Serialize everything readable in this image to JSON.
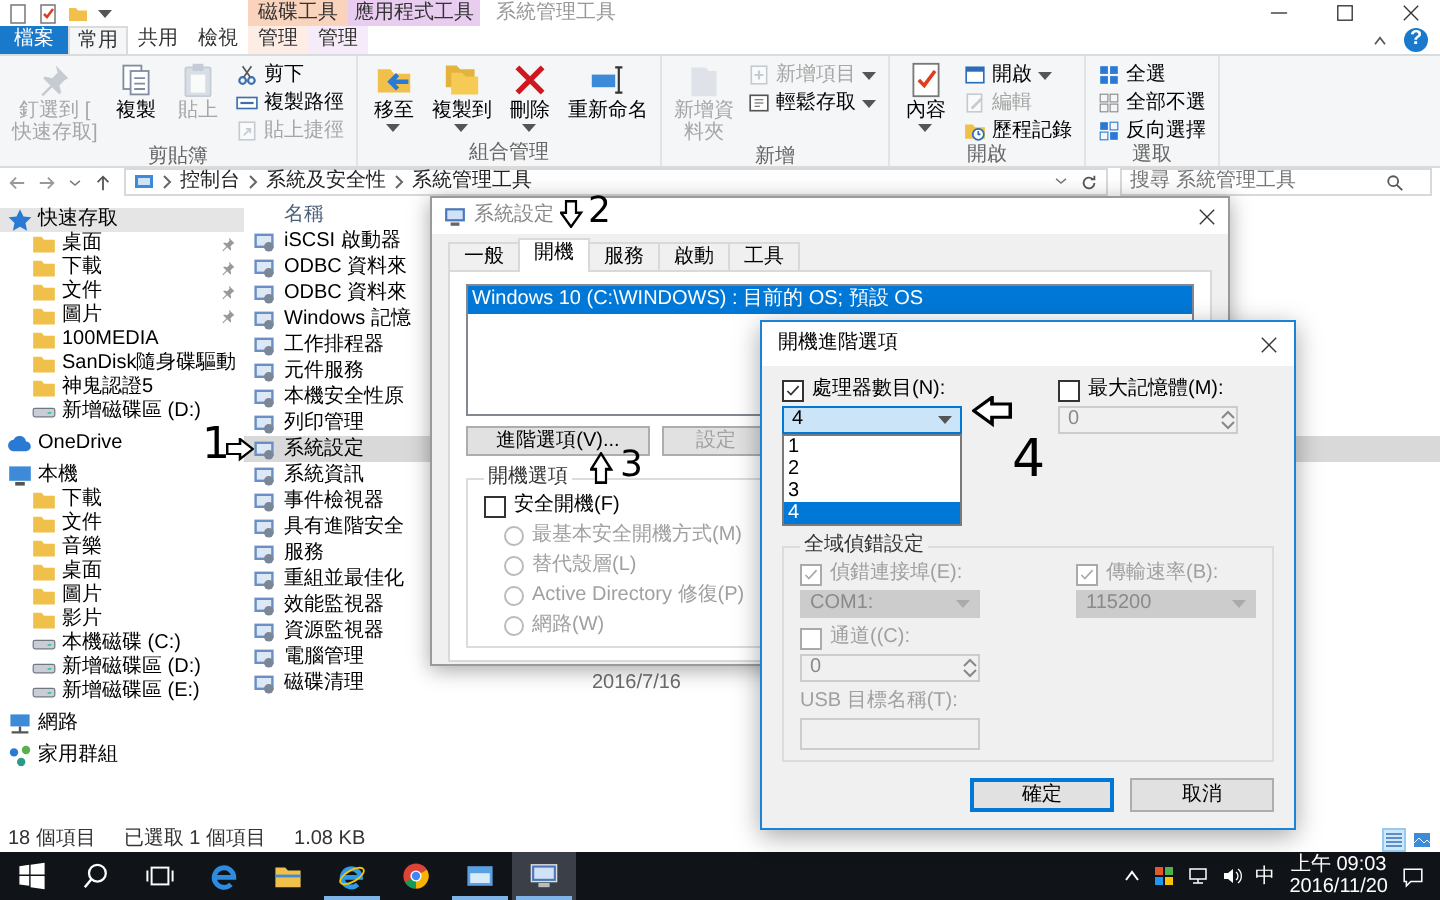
{
  "explorer": {
    "context_tabs": [
      {
        "group": "磁碟工具",
        "tab": "管理",
        "color": "#f9d3bc",
        "selected": false
      },
      {
        "group": "應用程式工具",
        "tab": "管理",
        "color": "#e9cdf0",
        "selected": false
      }
    ],
    "title": "系統管理工具",
    "ribbon_tabs": [
      {
        "label": "檔案",
        "kind": "file",
        "selected": false
      },
      {
        "label": "常用",
        "kind": "tab",
        "selected": true
      },
      {
        "label": "共用",
        "kind": "tab",
        "selected": false
      },
      {
        "label": "檢視",
        "kind": "tab",
        "selected": false
      }
    ],
    "help": "?",
    "ribbon_groups": [
      {
        "label": "剪貼簿",
        "commands": [
          {
            "label": "釘選到 [\n快速存取]",
            "kind": "large",
            "disabled": true,
            "dropdown": false
          },
          {
            "label": "複製",
            "kind": "large",
            "disabled": false,
            "dropdown": false
          },
          {
            "label": "貼上",
            "kind": "large",
            "disabled": true,
            "dropdown": false
          },
          {
            "label": "剪下",
            "kind": "small",
            "disabled": false,
            "dropdown": false
          },
          {
            "label": "複製路徑",
            "kind": "small",
            "disabled": false,
            "dropdown": false
          },
          {
            "label": "貼上捷徑",
            "kind": "small",
            "disabled": true,
            "dropdown": false
          }
        ]
      },
      {
        "label": "組合管理",
        "commands": [
          {
            "label": "移至",
            "kind": "large",
            "disabled": false,
            "dropdown": true
          },
          {
            "label": "複製到",
            "kind": "large",
            "disabled": false,
            "dropdown": true
          },
          {
            "label": "刪除",
            "kind": "large",
            "disabled": false,
            "dropdown": true
          },
          {
            "label": "重新命名",
            "kind": "large",
            "disabled": false,
            "dropdown": false
          }
        ]
      },
      {
        "label": "新增",
        "commands": [
          {
            "label": "新增資料夾",
            "kind": "large",
            "disabled": true,
            "dropdown": false
          },
          {
            "label": "新增項目",
            "kind": "small",
            "disabled": true,
            "dropdown": true
          },
          {
            "label": "輕鬆存取",
            "kind": "small",
            "disabled": false,
            "dropdown": true
          }
        ]
      },
      {
        "label": "開啟",
        "commands": [
          {
            "label": "內容",
            "kind": "large",
            "disabled": false,
            "dropdown": true
          },
          {
            "label": "開啟",
            "kind": "small",
            "disabled": false,
            "dropdown": true
          },
          {
            "label": "編輯",
            "kind": "small",
            "disabled": true,
            "dropdown": false
          },
          {
            "label": "歷程記錄",
            "kind": "small",
            "disabled": false,
            "dropdown": false
          }
        ]
      },
      {
        "label": "選取",
        "commands": [
          {
            "label": "全選",
            "kind": "small",
            "disabled": false,
            "dropdown": false
          },
          {
            "label": "全部不選",
            "kind": "small",
            "disabled": false,
            "dropdown": false
          },
          {
            "label": "反向選擇",
            "kind": "small",
            "disabled": false,
            "dropdown": false
          }
        ]
      }
    ],
    "address": {
      "path": [
        "控制台",
        "系統及安全性",
        "系統管理工具"
      ]
    },
    "search": {
      "placeholder": "搜尋 系統管理工具"
    },
    "nav": [
      {
        "label": "快速存取",
        "kind": "star",
        "selected": true,
        "children": [
          {
            "label": "桌面",
            "kind": "folder",
            "selected": false,
            "pinned": true
          },
          {
            "label": "下載",
            "kind": "folder",
            "selected": false,
            "pinned": true
          },
          {
            "label": "文件",
            "kind": "folder",
            "selected": false,
            "pinned": true
          },
          {
            "label": "圖片",
            "kind": "folder",
            "selected": false,
            "pinned": true
          },
          {
            "label": "100MEDIA",
            "kind": "folder",
            "selected": false,
            "pinned": false
          },
          {
            "label": "SanDisk隨身碟驅動",
            "kind": "folder",
            "selected": false,
            "pinned": false
          },
          {
            "label": "神鬼認證5",
            "kind": "folder",
            "selected": false,
            "pinned": false
          },
          {
            "label": "新增磁碟區 (D:)",
            "kind": "drive",
            "selected": false,
            "pinned": false
          }
        ]
      },
      {
        "label": "OneDrive",
        "kind": "cloud",
        "selected": false
      },
      {
        "label": "本機",
        "kind": "pc",
        "selected": false,
        "children": [
          {
            "label": "下載",
            "kind": "folder",
            "selected": false
          },
          {
            "label": "文件",
            "kind": "folder",
            "selected": false
          },
          {
            "label": "音樂",
            "kind": "folder",
            "selected": false
          },
          {
            "label": "桌面",
            "kind": "folder",
            "selected": false
          },
          {
            "label": "圖片",
            "kind": "folder",
            "selected": false
          },
          {
            "label": "影片",
            "kind": "folder",
            "selected": false
          },
          {
            "label": "本機磁碟 (C:)",
            "kind": "drive",
            "selected": false
          },
          {
            "label": "新增磁碟區 (D:)",
            "kind": "drive",
            "selected": false
          },
          {
            "label": "新增磁碟區 (E:)",
            "kind": "drive",
            "selected": false
          }
        ]
      },
      {
        "label": "網路",
        "kind": "network",
        "selected": false
      },
      {
        "label": "家用群組",
        "kind": "homegroup",
        "selected": false
      }
    ],
    "columns": [
      "名稱"
    ],
    "files": [
      {
        "name": "iSCSI 啟動器",
        "selected": false
      },
      {
        "name": "ODBC 資料來",
        "selected": false
      },
      {
        "name": "ODBC 資料來",
        "selected": false
      },
      {
        "name": "Windows 記憶",
        "selected": false
      },
      {
        "name": "工作排程器",
        "selected": false
      },
      {
        "name": "元件服務",
        "selected": false
      },
      {
        "name": "本機安全性原",
        "selected": false
      },
      {
        "name": "列印管理",
        "selected": false
      },
      {
        "name": "系統設定",
        "selected": true
      },
      {
        "name": "系統資訊",
        "selected": false
      },
      {
        "name": "事件檢視器",
        "selected": false
      },
      {
        "name": "具有進階安全",
        "selected": false
      },
      {
        "name": "服務",
        "selected": false
      },
      {
        "name": "重組並最佳化",
        "selected": false
      },
      {
        "name": "效能監視器",
        "selected": false
      },
      {
        "name": "資源監視器",
        "selected": false
      },
      {
        "name": "電腦管理",
        "selected": false
      },
      {
        "name": "磁碟清理",
        "selected": false,
        "date": "2016/7/16"
      }
    ],
    "status": {
      "count": "18 個項目",
      "selection": "已選取 1 個項目",
      "size": "1.08 KB"
    },
    "view_buttons": [
      {
        "selected": true
      },
      {
        "selected": false
      }
    ]
  },
  "system_config": {
    "title": "系統設定",
    "tabs": [
      {
        "label": "一般",
        "selected": false
      },
      {
        "label": "開機",
        "selected": true
      },
      {
        "label": "服務",
        "selected": false
      },
      {
        "label": "啟動",
        "selected": false
      },
      {
        "label": "工具",
        "selected": false
      }
    ],
    "boot_entries": [
      {
        "label": "Windows 10 (C:\\WINDOWS) : 目前的 OS; 預設 OS",
        "selected": true
      }
    ],
    "buttons": [
      {
        "label": "進階選項(V)...",
        "disabled": false
      },
      {
        "label": "設定",
        "disabled": true
      }
    ],
    "boot_options": {
      "label": "開機選項",
      "safe_boot": {
        "label": "安全開機(F)",
        "checked": false
      },
      "modes": [
        {
          "label": "最基本安全開機方式(M)",
          "selected": false,
          "disabled": true
        },
        {
          "label": "替代殼層(L)",
          "selected": false,
          "disabled": true
        },
        {
          "label": "Active Directory 修復(P)",
          "selected": false,
          "disabled": true
        },
        {
          "label": "網路(W)",
          "selected": false,
          "disabled": true
        }
      ]
    }
  },
  "advanced_boot": {
    "title": "開機進階選項",
    "processors": {
      "label": "處理器數目(N):",
      "checked": true,
      "value": "4",
      "options": [
        {
          "label": "1",
          "selected": false
        },
        {
          "label": "2",
          "selected": false
        },
        {
          "label": "3",
          "selected": false
        },
        {
          "label": "4",
          "selected": true
        }
      ]
    },
    "max_memory": {
      "label": "最大記憶體(M):",
      "checked": false,
      "value": "0",
      "disabled": true
    },
    "debug": {
      "label": "全域偵錯設定",
      "port": {
        "label": "偵錯連接埠(E):",
        "checked": true,
        "disabled": true,
        "value": "COM1:"
      },
      "baud": {
        "label": "傳輸速率(B):",
        "checked": true,
        "disabled": true,
        "value": "115200"
      },
      "channel": {
        "label": "通道((C):",
        "checked": false,
        "disabled": true,
        "value": "0"
      },
      "usb": {
        "label": "USB 目標名稱(T):",
        "disabled": true
      }
    },
    "buttons": [
      {
        "label": "確定",
        "default": true
      },
      {
        "label": "取消",
        "default": false
      }
    ]
  },
  "annotations": [
    {
      "label": "1",
      "kind": "arrow_right"
    },
    {
      "label": "2",
      "kind": "arrow_down"
    },
    {
      "label": "3",
      "kind": "arrow_up"
    },
    {
      "label": "4",
      "kind": "arrow_left"
    }
  ],
  "taskbar": {
    "apps": [
      {
        "running": false,
        "selected": false
      },
      {
        "running": false,
        "selected": false
      },
      {
        "running": false,
        "selected": false
      },
      {
        "running": false,
        "selected": false
      },
      {
        "running": false,
        "selected": false
      },
      {
        "running": true,
        "selected": false
      },
      {
        "running": false,
        "selected": false
      },
      {
        "running": true,
        "selected": false
      },
      {
        "running": true,
        "selected": true
      }
    ],
    "tray": {
      "ime": "中",
      "time": "上午 09:03",
      "date": "2016/11/20"
    }
  }
}
